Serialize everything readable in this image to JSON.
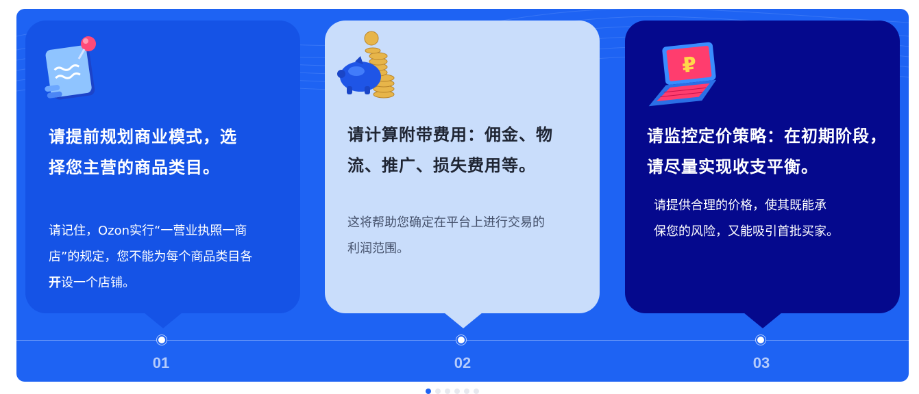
{
  "steps": [
    {
      "number": "01",
      "icon": "pin-document-icon",
      "heading_line1": "请提前规划商业模式，选",
      "heading_line2": "择您主营的商品类目。",
      "desc_line1": "请记住，Ozon实行“一营业执照一商",
      "desc_line2": "店”的规定，您不能为每个商品类目各",
      "desc_line3_bold": "开",
      "desc_line3_rest": "设一个店铺。"
    },
    {
      "number": "02",
      "icon": "piggy-bank-coins-icon",
      "heading_line1": "请计算附带费用：佣金、物",
      "heading_line2": "流、推广、损失费用等。",
      "desc_line1": "这将帮助您确定在平台上进行交易的",
      "desc_line2": "利润范围。"
    },
    {
      "number": "03",
      "icon": "laptop-ruble-icon",
      "heading_line1": "请监控定价策略：在初期阶段，",
      "heading_line2": "请尽量实现收支平衡。",
      "desc_line1": "请提供合理的价格，使其既能承",
      "desc_line2": "保您的风险，又能吸引首批买家。"
    }
  ],
  "colors": {
    "banner_bg": "#1e63f3",
    "card1_bg": "#1553e6",
    "card2_bg": "#c9ddfb",
    "card3_bg": "#05098d",
    "number_color": "#b4cbfb"
  },
  "carousel": {
    "page_count": 6,
    "active_index": 0
  }
}
